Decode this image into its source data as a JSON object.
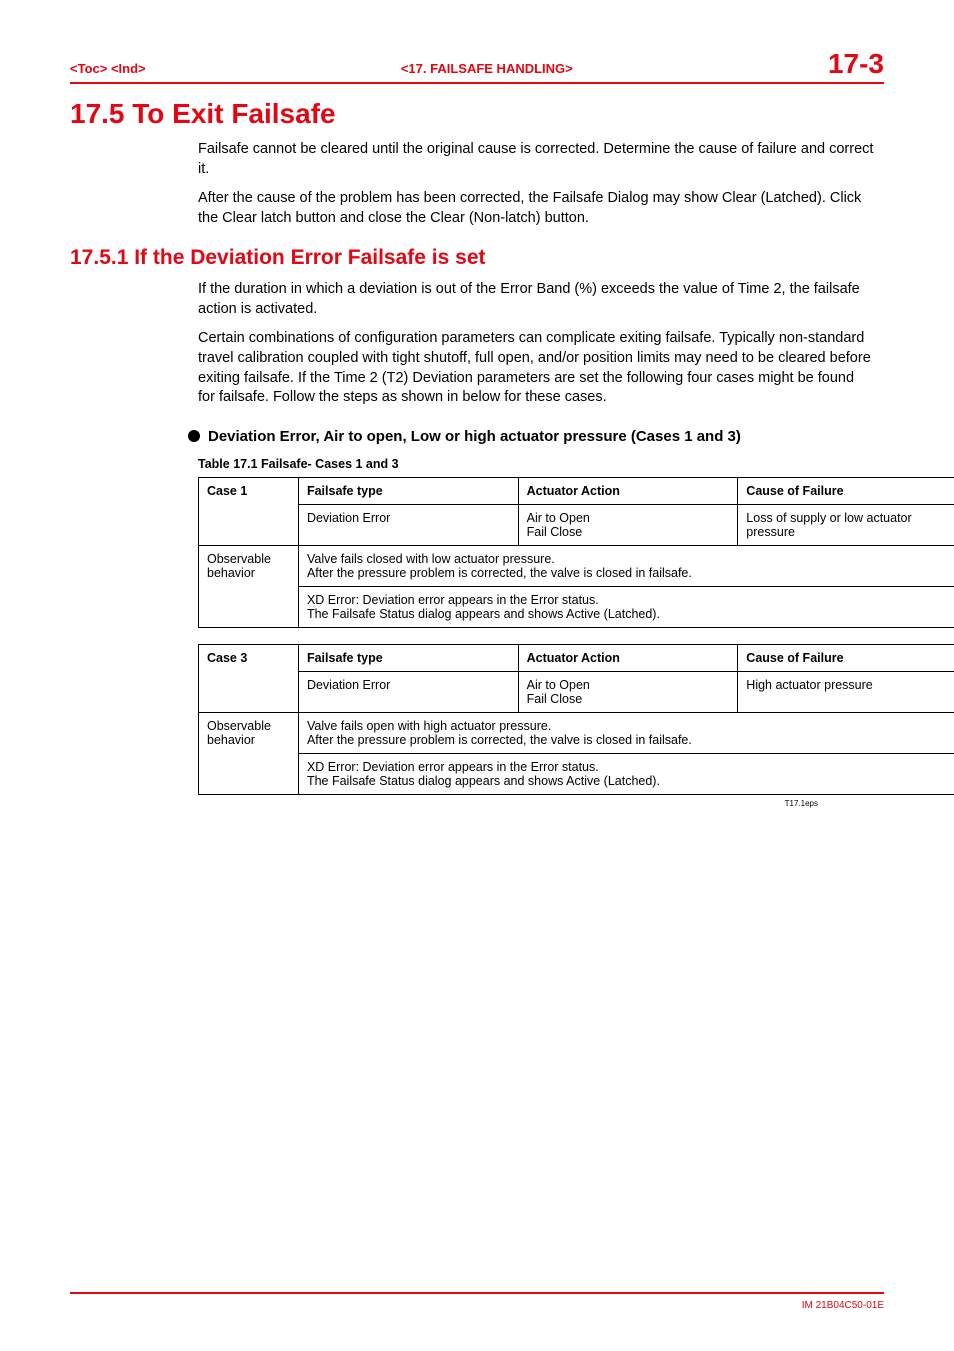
{
  "header": {
    "left": "<Toc> <Ind>",
    "center": "<17.  FAILSAFE HANDLING>",
    "right": "17-3"
  },
  "section": {
    "number_title": "17.5  To Exit Failsafe",
    "para1": "Failsafe cannot be cleared until the original cause is corrected.  Determine the cause of failure and correct it.",
    "para2": "After the cause of the problem has been corrected, the Failsafe Dialog may show Clear (Latched).  Click the Clear latch button and close the Clear (Non-latch) button."
  },
  "subsection": {
    "title": "17.5.1  If the Deviation Error Failsafe is set",
    "para1": "If the duration in which a deviation is out of the Error Band (%) exceeds the value of Time 2, the failsafe action is activated.",
    "para2": "Certain combinations of configuration parameters can complicate exiting failsafe.  Typically non-standard travel calibration coupled with tight shutoff, full open, and/or position limits may need to be cleared before exiting failsafe.  If the Time 2 (T2) Deviation parameters are set the following four cases might be found for failsafe.  Follow the steps as shown in below for these cases."
  },
  "bullet": {
    "text": "Deviation Error, Air to open, Low or high actuator pressure (Cases 1 and 3)"
  },
  "tableCaption": "Table 17.1  Failsafe- Cases 1 and 3",
  "table1": {
    "head": {
      "c1": "Case 1",
      "c2": "Failsafe type",
      "c3": "Actuator Action",
      "c4": "Cause of Failure"
    },
    "row1": {
      "c2": "Deviation Error",
      "c3": "Air to Open\nFail Close",
      "c4": "Loss of supply or low actuator pressure"
    },
    "row2": {
      "c1": "Observable behavior",
      "c2": "Valve fails closed with low actuator pressure.\nAfter the pressure problem is corrected, the valve is closed in failsafe."
    },
    "row3": {
      "c2": "XD Error: Deviation error appears in the Error status.\nThe Failsafe Status dialog appears and shows Active (Latched)."
    }
  },
  "table2": {
    "head": {
      "c1": "Case 3",
      "c2": "Failsafe type",
      "c3": "Actuator Action",
      "c4": "Cause of Failure"
    },
    "row1": {
      "c2": "Deviation Error",
      "c3": "Air to Open\nFail Close",
      "c4": "High actuator pressure"
    },
    "row2": {
      "c1": "Observable behavior",
      "c2": "Valve fails open with high actuator pressure.\nAfter the pressure problem is corrected, the valve is closed in failsafe."
    },
    "row3": {
      "c2": "XD Error: Deviation error appears in the Error status.\nThe Failsafe Status dialog appears and shows Active (Latched)."
    }
  },
  "noteRight": "T17.1eps",
  "footer": "IM 21B04C50-01E"
}
